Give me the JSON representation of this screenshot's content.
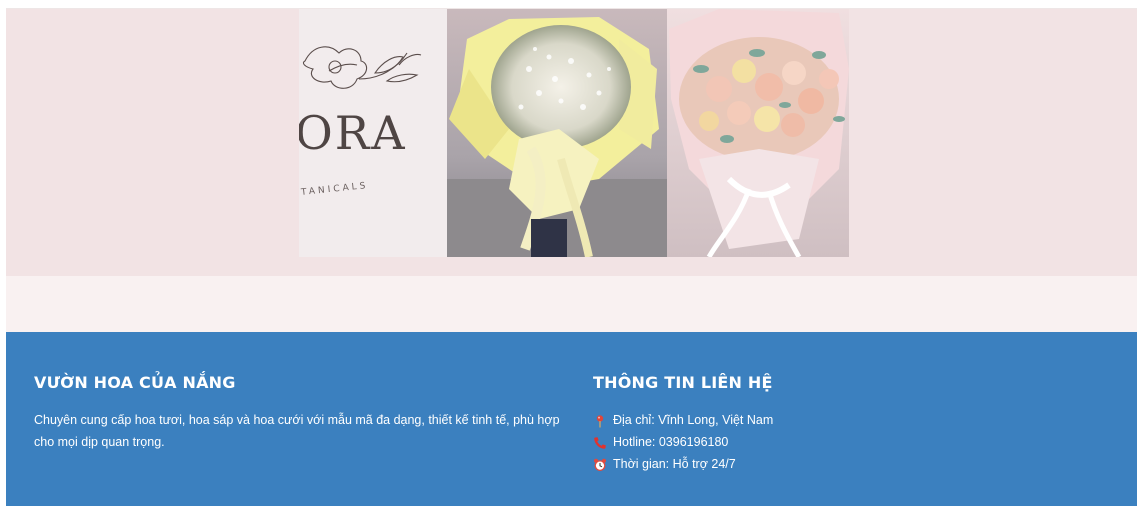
{
  "banner": {
    "logo_text": "ORA",
    "logo_subtext": "TANICALS"
  },
  "footer": {
    "about": {
      "title": "VƯỜN HOA CỦA NẮNG",
      "description": "Chuyên cung cấp hoa tươi, hoa sáp và hoa cưới với mẫu mã đa dạng, thiết kế tinh tế, phù hợp cho mọi dịp quan trọng."
    },
    "contact": {
      "title": "THÔNG TIN LIÊN HỆ",
      "address": "Địa chỉ: Vĩnh Long, Việt Nam",
      "hotline": "Hotline: 0396196180",
      "hours": "Thời gian: Hỗ trợ 24/7"
    }
  },
  "colors": {
    "hero_bg": "#f2e3e4",
    "spacer_bg": "#f9f1f1",
    "footer_bg": "#3b80bf",
    "footer_text": "#ffffff",
    "pin_icon": "#e0453a",
    "phone_icon": "#e0332f",
    "clock_icon": "#e04a3f"
  },
  "icons": {
    "address": "map-pin-icon",
    "hotline": "phone-icon",
    "hours": "alarm-clock-icon"
  }
}
